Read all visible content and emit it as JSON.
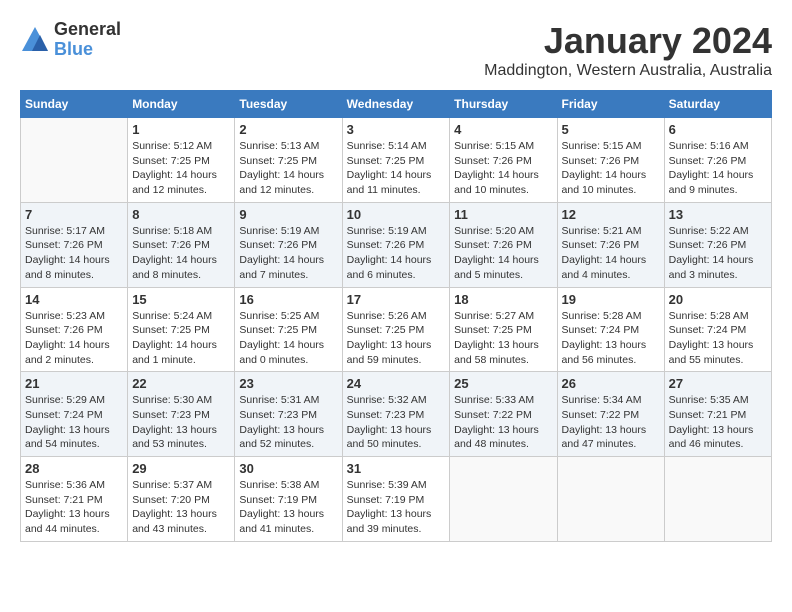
{
  "logo": {
    "general": "General",
    "blue": "Blue"
  },
  "title": "January 2024",
  "location": "Maddington, Western Australia, Australia",
  "days_header": [
    "Sunday",
    "Monday",
    "Tuesday",
    "Wednesday",
    "Thursday",
    "Friday",
    "Saturday"
  ],
  "weeks": [
    [
      {
        "day": "",
        "info": ""
      },
      {
        "day": "1",
        "info": "Sunrise: 5:12 AM\nSunset: 7:25 PM\nDaylight: 14 hours\nand 12 minutes."
      },
      {
        "day": "2",
        "info": "Sunrise: 5:13 AM\nSunset: 7:25 PM\nDaylight: 14 hours\nand 12 minutes."
      },
      {
        "day": "3",
        "info": "Sunrise: 5:14 AM\nSunset: 7:25 PM\nDaylight: 14 hours\nand 11 minutes."
      },
      {
        "day": "4",
        "info": "Sunrise: 5:15 AM\nSunset: 7:26 PM\nDaylight: 14 hours\nand 10 minutes."
      },
      {
        "day": "5",
        "info": "Sunrise: 5:15 AM\nSunset: 7:26 PM\nDaylight: 14 hours\nand 10 minutes."
      },
      {
        "day": "6",
        "info": "Sunrise: 5:16 AM\nSunset: 7:26 PM\nDaylight: 14 hours\nand 9 minutes."
      }
    ],
    [
      {
        "day": "7",
        "info": "Sunrise: 5:17 AM\nSunset: 7:26 PM\nDaylight: 14 hours\nand 8 minutes."
      },
      {
        "day": "8",
        "info": "Sunrise: 5:18 AM\nSunset: 7:26 PM\nDaylight: 14 hours\nand 8 minutes."
      },
      {
        "day": "9",
        "info": "Sunrise: 5:19 AM\nSunset: 7:26 PM\nDaylight: 14 hours\nand 7 minutes."
      },
      {
        "day": "10",
        "info": "Sunrise: 5:19 AM\nSunset: 7:26 PM\nDaylight: 14 hours\nand 6 minutes."
      },
      {
        "day": "11",
        "info": "Sunrise: 5:20 AM\nSunset: 7:26 PM\nDaylight: 14 hours\nand 5 minutes."
      },
      {
        "day": "12",
        "info": "Sunrise: 5:21 AM\nSunset: 7:26 PM\nDaylight: 14 hours\nand 4 minutes."
      },
      {
        "day": "13",
        "info": "Sunrise: 5:22 AM\nSunset: 7:26 PM\nDaylight: 14 hours\nand 3 minutes."
      }
    ],
    [
      {
        "day": "14",
        "info": "Sunrise: 5:23 AM\nSunset: 7:26 PM\nDaylight: 14 hours\nand 2 minutes."
      },
      {
        "day": "15",
        "info": "Sunrise: 5:24 AM\nSunset: 7:25 PM\nDaylight: 14 hours\nand 1 minute."
      },
      {
        "day": "16",
        "info": "Sunrise: 5:25 AM\nSunset: 7:25 PM\nDaylight: 14 hours\nand 0 minutes."
      },
      {
        "day": "17",
        "info": "Sunrise: 5:26 AM\nSunset: 7:25 PM\nDaylight: 13 hours\nand 59 minutes."
      },
      {
        "day": "18",
        "info": "Sunrise: 5:27 AM\nSunset: 7:25 PM\nDaylight: 13 hours\nand 58 minutes."
      },
      {
        "day": "19",
        "info": "Sunrise: 5:28 AM\nSunset: 7:24 PM\nDaylight: 13 hours\nand 56 minutes."
      },
      {
        "day": "20",
        "info": "Sunrise: 5:28 AM\nSunset: 7:24 PM\nDaylight: 13 hours\nand 55 minutes."
      }
    ],
    [
      {
        "day": "21",
        "info": "Sunrise: 5:29 AM\nSunset: 7:24 PM\nDaylight: 13 hours\nand 54 minutes."
      },
      {
        "day": "22",
        "info": "Sunrise: 5:30 AM\nSunset: 7:23 PM\nDaylight: 13 hours\nand 53 minutes."
      },
      {
        "day": "23",
        "info": "Sunrise: 5:31 AM\nSunset: 7:23 PM\nDaylight: 13 hours\nand 52 minutes."
      },
      {
        "day": "24",
        "info": "Sunrise: 5:32 AM\nSunset: 7:23 PM\nDaylight: 13 hours\nand 50 minutes."
      },
      {
        "day": "25",
        "info": "Sunrise: 5:33 AM\nSunset: 7:22 PM\nDaylight: 13 hours\nand 48 minutes."
      },
      {
        "day": "26",
        "info": "Sunrise: 5:34 AM\nSunset: 7:22 PM\nDaylight: 13 hours\nand 47 minutes."
      },
      {
        "day": "27",
        "info": "Sunrise: 5:35 AM\nSunset: 7:21 PM\nDaylight: 13 hours\nand 46 minutes."
      }
    ],
    [
      {
        "day": "28",
        "info": "Sunrise: 5:36 AM\nSunset: 7:21 PM\nDaylight: 13 hours\nand 44 minutes."
      },
      {
        "day": "29",
        "info": "Sunrise: 5:37 AM\nSunset: 7:20 PM\nDaylight: 13 hours\nand 43 minutes."
      },
      {
        "day": "30",
        "info": "Sunrise: 5:38 AM\nSunset: 7:19 PM\nDaylight: 13 hours\nand 41 minutes."
      },
      {
        "day": "31",
        "info": "Sunrise: 5:39 AM\nSunset: 7:19 PM\nDaylight: 13 hours\nand 39 minutes."
      },
      {
        "day": "",
        "info": ""
      },
      {
        "day": "",
        "info": ""
      },
      {
        "day": "",
        "info": ""
      }
    ]
  ]
}
